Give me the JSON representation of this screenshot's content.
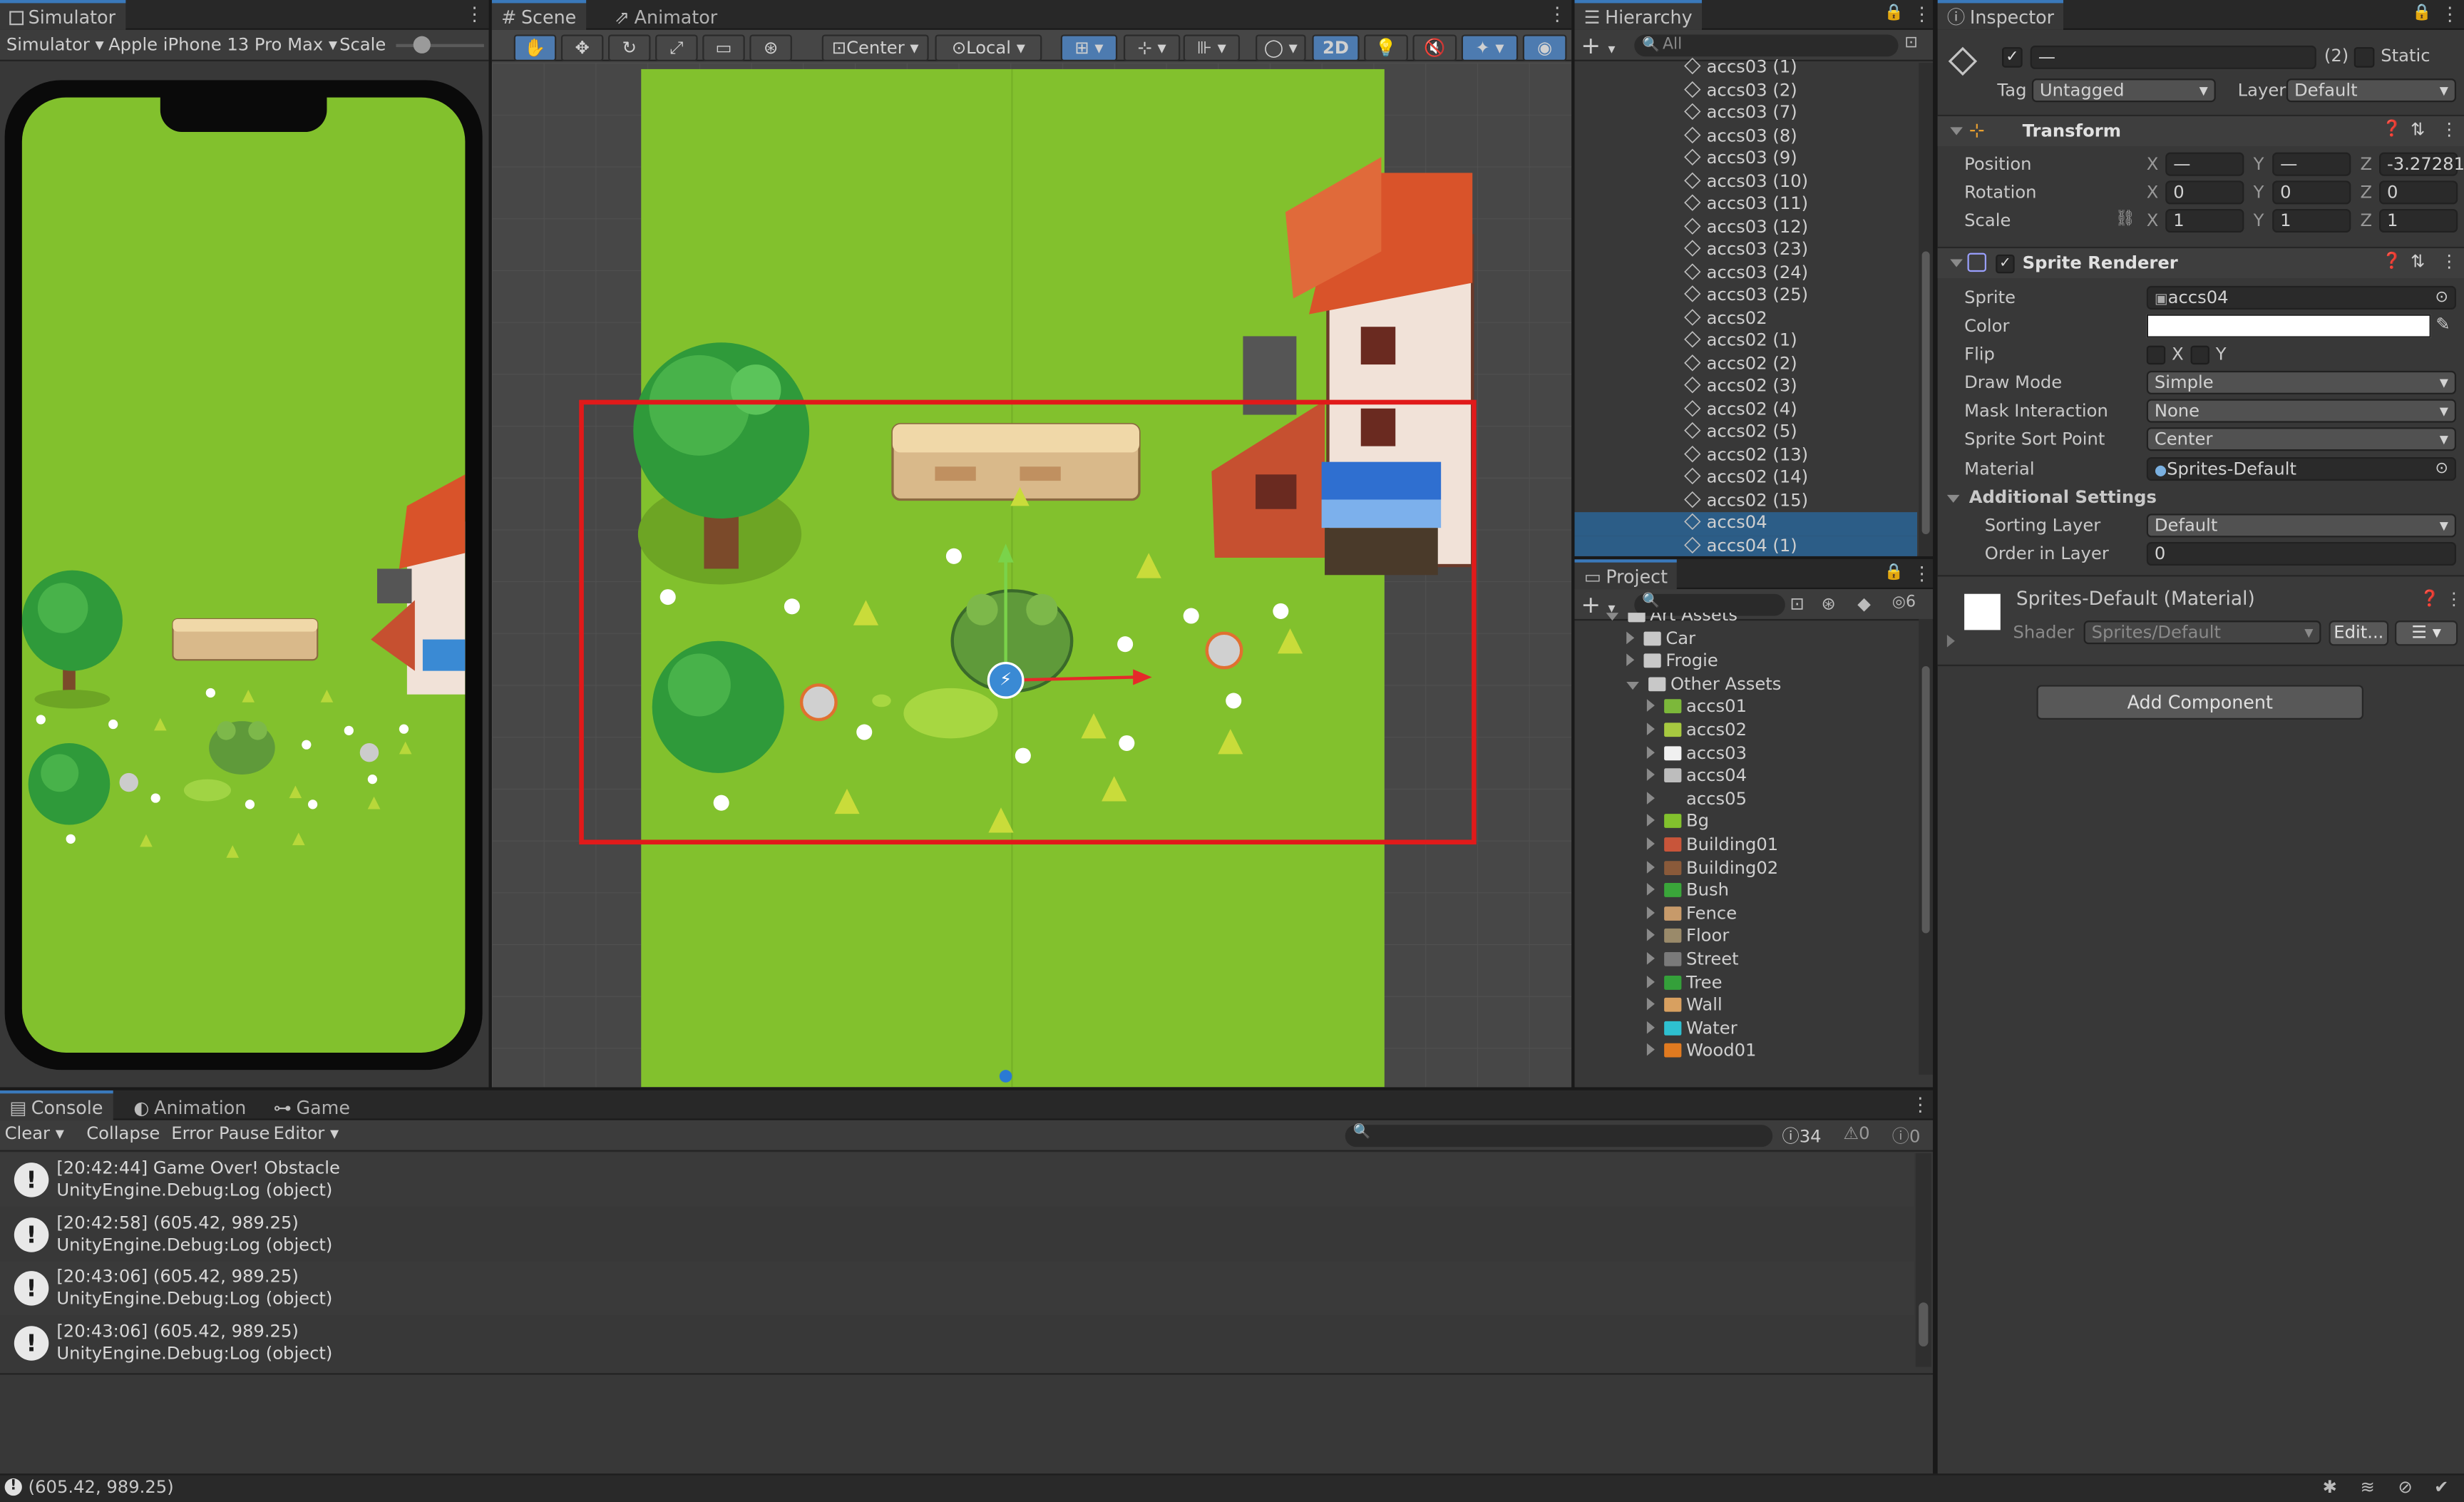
{
  "simulator": {
    "tab": "Simulator",
    "mode": "Simulator",
    "device": "Apple iPhone 13 Pro Max",
    "scale_label": "Scale"
  },
  "scene": {
    "tabs": [
      "Scene",
      "Animator"
    ],
    "pivot": "Center",
    "space": "Local",
    "toggle_2d": "2D"
  },
  "hierarchy": {
    "tab": "Hierarchy",
    "search_placeholder": "All",
    "items": [
      "accs03 (1)",
      "accs03 (2)",
      "accs03 (7)",
      "accs03 (8)",
      "accs03 (9)",
      "accs03 (10)",
      "accs03 (11)",
      "accs03 (12)",
      "accs03 (23)",
      "accs03 (24)",
      "accs03 (25)",
      "accs02",
      "accs02 (1)",
      "accs02 (2)",
      "accs02 (3)",
      "accs02 (4)",
      "accs02 (5)",
      "accs02 (13)",
      "accs02 (14)",
      "accs02 (15)",
      "accs04",
      "accs04 (1)"
    ],
    "selected": [
      "accs04",
      "accs04 (1)"
    ]
  },
  "project": {
    "tab": "Project",
    "hidden_count": "6",
    "items": [
      {
        "label": "Art Assets",
        "depth": 0,
        "kind": "folder-open"
      },
      {
        "label": "Car",
        "depth": 1,
        "kind": "folder"
      },
      {
        "label": "Frogie",
        "depth": 1,
        "kind": "folder"
      },
      {
        "label": "Other Assets",
        "depth": 1,
        "kind": "folder-open"
      },
      {
        "label": "accs01",
        "depth": 2,
        "kind": "sprite",
        "color": "#7cb83a"
      },
      {
        "label": "accs02",
        "depth": 2,
        "kind": "sprite",
        "color": "#a7c940"
      },
      {
        "label": "accs03",
        "depth": 2,
        "kind": "sprite",
        "color": "#f0f0f0"
      },
      {
        "label": "accs04",
        "depth": 2,
        "kind": "sprite",
        "color": "#bdbdbd"
      },
      {
        "label": "accs05",
        "depth": 2,
        "kind": "sprite",
        "color": "#383838"
      },
      {
        "label": "Bg",
        "depth": 2,
        "kind": "sprite",
        "color": "#82c12d"
      },
      {
        "label": "Building01",
        "depth": 2,
        "kind": "sprite",
        "color": "#c8553a"
      },
      {
        "label": "Building02",
        "depth": 2,
        "kind": "sprite",
        "color": "#8a5a3a"
      },
      {
        "label": "Bush",
        "depth": 2,
        "kind": "sprite",
        "color": "#3aa63a"
      },
      {
        "label": "Fence",
        "depth": 2,
        "kind": "sprite",
        "color": "#c79a6a"
      },
      {
        "label": "Floor",
        "depth": 2,
        "kind": "sprite",
        "color": "#9a8a6a"
      },
      {
        "label": "Street",
        "depth": 2,
        "kind": "sprite",
        "color": "#7a7a7a"
      },
      {
        "label": "Tree",
        "depth": 2,
        "kind": "sprite",
        "color": "#34a03a"
      },
      {
        "label": "Wall",
        "depth": 2,
        "kind": "sprite",
        "color": "#d8a060"
      },
      {
        "label": "Water",
        "depth": 2,
        "kind": "sprite",
        "color": "#2ec0d0"
      },
      {
        "label": "Wood01",
        "depth": 2,
        "kind": "sprite",
        "color": "#e07a20"
      }
    ]
  },
  "inspector": {
    "tab": "Inspector",
    "name_value": "—",
    "count": "(2)",
    "static_label": "Static",
    "tag_label": "Tag",
    "tag_value": "Untagged",
    "layer_label": "Layer",
    "layer_value": "Default",
    "transform": {
      "title": "Transform",
      "position_label": "Position",
      "rotation_label": "Rotation",
      "scale_label": "Scale",
      "pos_x": "—",
      "pos_y": "—",
      "pos_z": "-3.27281",
      "rot_x": "0",
      "rot_y": "0",
      "rot_z": "0",
      "scl_x": "1",
      "scl_y": "1",
      "scl_z": "1"
    },
    "sprite_renderer": {
      "title": "Sprite Renderer",
      "sprite_label": "Sprite",
      "sprite_value": "accs04",
      "color_label": "Color",
      "flip_label": "Flip",
      "flip_x": "X",
      "flip_y": "Y",
      "draw_mode_label": "Draw Mode",
      "draw_mode_value": "Simple",
      "mask_label": "Mask Interaction",
      "mask_value": "None",
      "sort_point_label": "Sprite Sort Point",
      "sort_point_value": "Center",
      "material_label": "Material",
      "material_value": "Sprites-Default",
      "additional_label": "Additional Settings",
      "sorting_layer_label": "Sorting Layer",
      "sorting_layer_value": "Default",
      "order_label": "Order in Layer",
      "order_value": "0"
    },
    "material": {
      "title": "Sprites-Default (Material)",
      "shader_label": "Shader",
      "shader_value": "Sprites/Default",
      "edit_label": "Edit..."
    },
    "add_component": "Add Component"
  },
  "console": {
    "tabs": [
      "Console",
      "Animation",
      "Game"
    ],
    "buttons": [
      "Clear",
      "Collapse",
      "Error Pause",
      "Editor"
    ],
    "counts": {
      "log": "34",
      "warn": "0",
      "error": "0"
    },
    "entries": [
      {
        "line1": "[20:42:44] Game Over! Obstacle",
        "line2": "UnityEngine.Debug:Log (object)"
      },
      {
        "line1": "[20:42:58] (605.42, 989.25)",
        "line2": "UnityEngine.Debug:Log (object)"
      },
      {
        "line1": "[20:43:06] (605.42, 989.25)",
        "line2": "UnityEngine.Debug:Log (object)"
      },
      {
        "line1": "[20:43:06] (605.42, 989.25)",
        "line2": "UnityEngine.Debug:Log (object)"
      }
    ]
  },
  "status_bar": {
    "message": "(605.42, 989.25)"
  },
  "colors": {
    "grass": "#82c12d",
    "selection": "#2c5d87",
    "camera_rect": "#e11a1a",
    "accent": "#3a79bb"
  }
}
